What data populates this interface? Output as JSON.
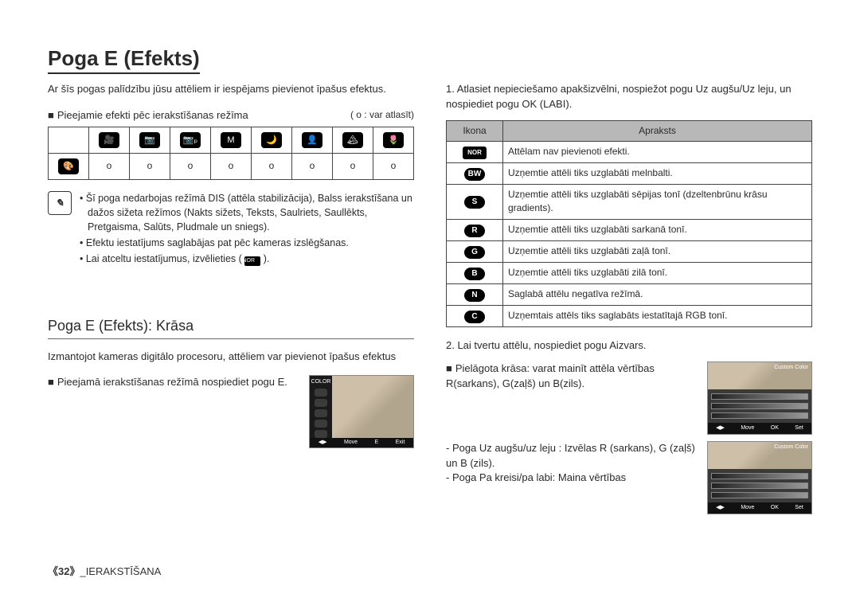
{
  "title": "Poga E (Efekts)",
  "intro": "Ar šīs pogas palīdzību jūsu attēliem ir iespējams pievienot īpašus efektus.",
  "modes_label": "Pieejamie efekti pēc ierakstīšanas režīma",
  "modes_hint": "( o : var atlasīt)",
  "mode_table": {
    "row_mark": "o"
  },
  "note": {
    "items": [
      "Šī poga nedarbojas režīmā DIS (attēla stabilizācija), Balss ierakstīšana un dažos sižeta režīmos (Nakts sižets, Teksts, Saulriets, Saullēkts, Pretgaisma, Salūts, Pludmale un sniegs).",
      "Efektu iestatījums saglabājas pat pēc kameras izslēgšanas.",
      "Lai atceltu iestatījumus, izvēlieties ( "
    ],
    "nor_tail": " )."
  },
  "sub_title": "Poga E (Efekts): Krāsa",
  "sub_intro": "Izmantojot kameras digitālo procesoru, attēliem var pievienot īpašus efektus",
  "step_press_e": "Pieejamā ierakstīšanas režīmā nospiediet pogu E.",
  "screen1": {
    "title": "COLOR",
    "foot_move": "Move",
    "foot_e": "E",
    "foot_exit": "Exit"
  },
  "right": {
    "step1": "1. Atlasiet nepieciešamo apakšizvēlni, nospiežot pogu Uz augšu/Uz leju, un nospiediet pogu OK (LABI).",
    "tbl_head_icon": "Ikona",
    "tbl_head_desc": "Apraksts",
    "rows": [
      {
        "icon": "NOR",
        "cls": "nor",
        "desc": "Attēlam nav pievienoti efekti."
      },
      {
        "icon": "BW",
        "cls": "",
        "desc": "Uzņemtie attēli tiks uzglabāti melnbalti."
      },
      {
        "icon": "S",
        "cls": "",
        "desc": "Uzņemtie attēli tiks uzglabāti sēpijas tonī (dzeltenbrūnu krāsu gradients)."
      },
      {
        "icon": "R",
        "cls": "",
        "desc": "Uzņemtie attēli tiks uzglabāti sarkanā tonī."
      },
      {
        "icon": "G",
        "cls": "",
        "desc": "Uzņemtie attēli tiks uzglabāti zaļā tonī."
      },
      {
        "icon": "B",
        "cls": "",
        "desc": "Uzņemtie attēli tiks uzglabāti zilā tonī."
      },
      {
        "icon": "N",
        "cls": "",
        "desc": "Saglabā attēlu negatīva režīmā."
      },
      {
        "icon": "C",
        "cls": "",
        "desc": "Uzņemtais attēls tiks saglabāts iestatītajā RGB tonī."
      }
    ],
    "step2": "2. Lai tvertu attēlu, nospiediet pogu Aizvars.",
    "custom_label": "Pielāgota krāsa: varat mainīt attēla vērtības R(sarkans), G(zaļš) un B(zils).",
    "custom_title": "Custom Color",
    "foot_move": "Move",
    "foot_ok": "OK",
    "foot_set": "Set",
    "bullets": [
      "- Poga Uz augšu/uz leju : Izvēlas R (sarkans), G (zaļš) un B (zils).",
      "- Poga Pa kreisi/pa labi: Maina vērtības"
    ]
  },
  "footer": {
    "page": "《32》",
    "section": "_IERAKSTĪŠANA"
  }
}
